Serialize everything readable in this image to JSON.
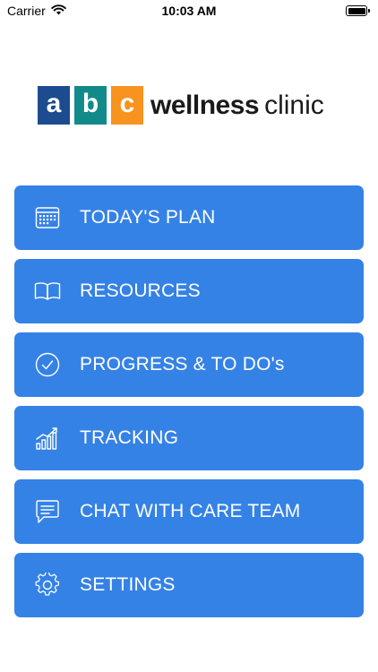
{
  "status_bar": {
    "carrier": "Carrier",
    "time": "10:03 AM",
    "wifi_icon": "wifi-icon",
    "battery_icon": "battery-icon"
  },
  "logo": {
    "letters": [
      "a",
      "b",
      "c"
    ],
    "letter_colors": [
      "#1d4b8f",
      "#138a8a",
      "#f7931e"
    ],
    "word_bold": "wellness",
    "word_light": "clinic"
  },
  "menu": {
    "items": [
      {
        "label": "TODAY'S PLAN",
        "icon": "calendar-icon"
      },
      {
        "label": "RESOURCES",
        "icon": "book-icon"
      },
      {
        "label": "PROGRESS & TO DO's",
        "icon": "checkmark-circle-icon"
      },
      {
        "label": "TRACKING",
        "icon": "chart-icon"
      },
      {
        "label": "CHAT WITH CARE TEAM",
        "icon": "chat-icon"
      },
      {
        "label": "SETTINGS",
        "icon": "gear-icon"
      }
    ]
  },
  "colors": {
    "button_background": "#3582e6",
    "button_text": "#ffffff"
  }
}
